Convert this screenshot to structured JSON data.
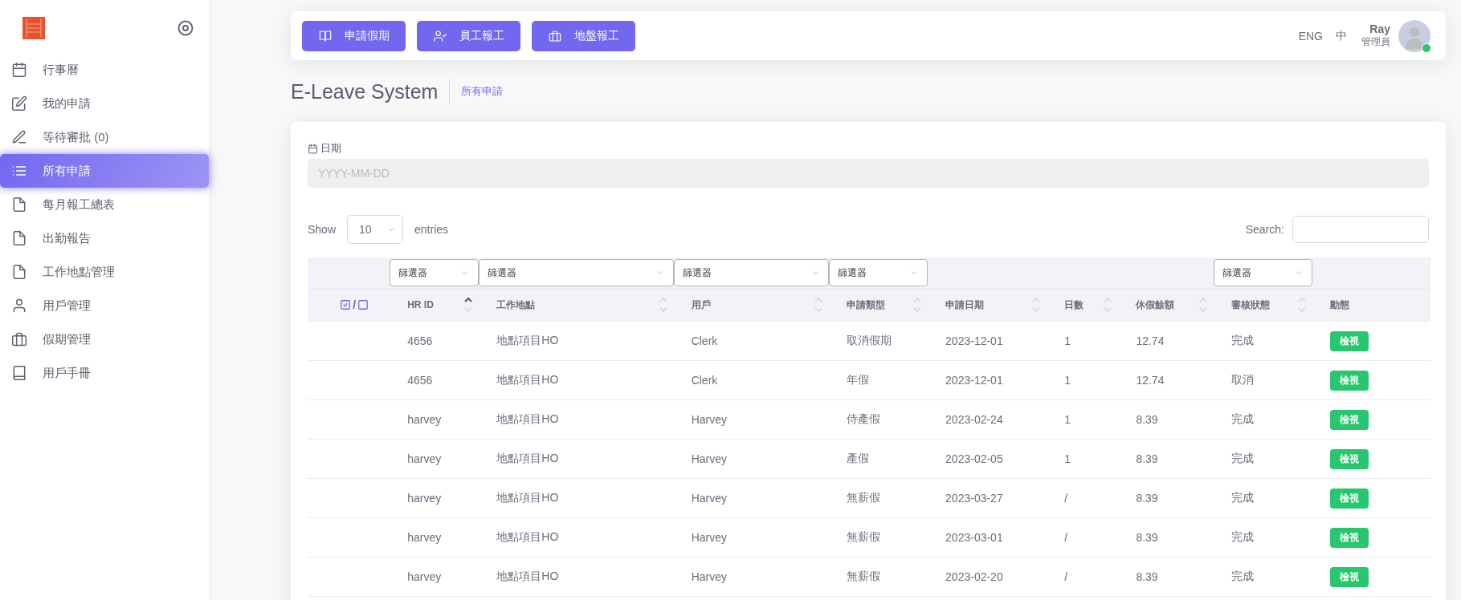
{
  "sidebar": {
    "items": [
      {
        "label": "行事曆",
        "selected": false
      },
      {
        "label": "我的申請",
        "selected": false
      },
      {
        "label": "等待審批 (0)",
        "selected": false
      },
      {
        "label": "所有申請",
        "selected": true
      },
      {
        "label": "每月報工總表",
        "selected": false
      },
      {
        "label": "出勤報告",
        "selected": false
      },
      {
        "label": "工作地點管理",
        "selected": false
      },
      {
        "label": "用戶管理",
        "selected": false
      },
      {
        "label": "假期管理",
        "selected": false
      },
      {
        "label": "用戶手冊",
        "selected": false
      }
    ]
  },
  "topbar": {
    "buttons": [
      "申請假期",
      "員工報工",
      "地盤報工"
    ],
    "languages": [
      "ENG",
      "中"
    ],
    "user": {
      "name": "Ray",
      "role": "管理員",
      "online": true
    }
  },
  "page": {
    "title": "E-Leave System",
    "breadcrumb": "所有申請"
  },
  "date_filter": {
    "label": "日期",
    "placeholder": "YYYY-MM-DD"
  },
  "length": {
    "show": "Show",
    "value": "10",
    "entries": "entries"
  },
  "search": {
    "label": "Search:"
  },
  "table": {
    "select_separator": "/",
    "columns": [
      {
        "label": "HR ID",
        "sortable": true,
        "sorted": true,
        "filter": "篩選器"
      },
      {
        "label": "工作地點",
        "sortable": true,
        "sorted": false,
        "filter": "篩選器"
      },
      {
        "label": "用戶",
        "sortable": true,
        "sorted": false,
        "filter": "篩選器"
      },
      {
        "label": "申請類型",
        "sortable": true,
        "sorted": false,
        "filter": "篩選器"
      },
      {
        "label": "申請日期",
        "sortable": true,
        "sorted": false
      },
      {
        "label": "日數",
        "sortable": true,
        "sorted": false
      },
      {
        "label": "休假餘額",
        "sortable": true,
        "sorted": false
      },
      {
        "label": "審核狀態",
        "sortable": true,
        "sorted": false,
        "filter": "篩選器"
      },
      {
        "label": "動態",
        "sortable": false
      }
    ],
    "rows": [
      {
        "cells": [
          "4656",
          "地點項目HO",
          "Clerk",
          "取消假期",
          "2023-12-01",
          "1",
          "12.74",
          "完成"
        ],
        "action": "檢視"
      },
      {
        "cells": [
          "4656",
          "地點項目HO",
          "Clerk",
          "年假",
          "2023-12-01",
          "1",
          "12.74",
          "取消"
        ],
        "action": "檢視"
      },
      {
        "cells": [
          "harvey",
          "地點項目HO",
          "Harvey",
          "侍產假",
          "2023-02-24",
          "1",
          "8.39",
          "完成"
        ],
        "action": "檢視"
      },
      {
        "cells": [
          "harvey",
          "地點項目HO",
          "Harvey",
          "產假",
          "2023-02-05",
          "1",
          "8.39",
          "完成"
        ],
        "action": "檢視"
      },
      {
        "cells": [
          "harvey",
          "地點項目HO",
          "Harvey",
          "無薪假",
          "2023-03-27",
          "/",
          "8.39",
          "完成"
        ],
        "action": "檢視"
      },
      {
        "cells": [
          "harvey",
          "地點項目HO",
          "Harvey",
          "無薪假",
          "2023-03-01",
          "/",
          "8.39",
          "完成"
        ],
        "action": "檢視"
      },
      {
        "cells": [
          "harvey",
          "地點項目HO",
          "Harvey",
          "無薪假",
          "2023-02-20",
          "/",
          "8.39",
          "完成"
        ],
        "action": "檢視"
      }
    ]
  }
}
